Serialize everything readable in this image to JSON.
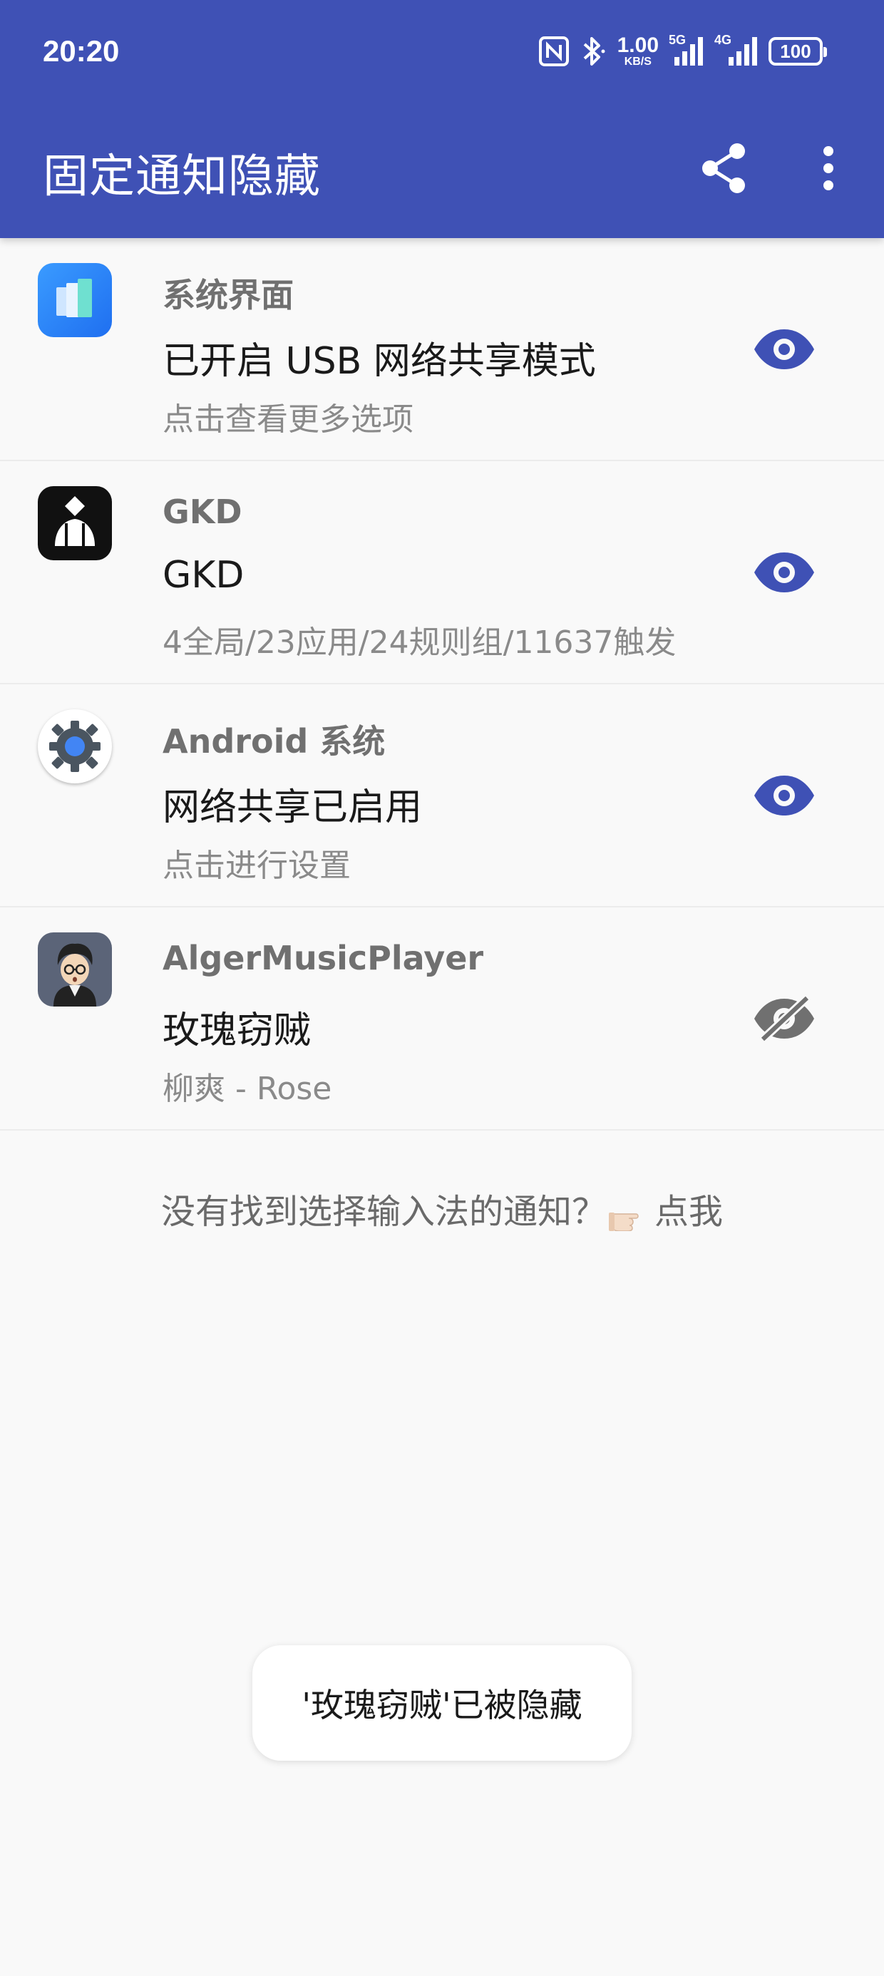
{
  "status_bar": {
    "time": "20:20",
    "net_speed_value": "1.00",
    "net_speed_unit": "KB/S",
    "signal_1_tag": "5G",
    "signal_2_tag": "4G",
    "battery": "100"
  },
  "app_bar": {
    "title": "固定通知隐藏",
    "share_icon": "share-icon",
    "more_icon": "more-vert-icon",
    "color": "#3f51b5"
  },
  "notifications": [
    {
      "app": "系统界面",
      "title": "已开启 USB 网络共享模式",
      "text": "点击查看更多选项",
      "icon": "system-ui-icon",
      "visible": true
    },
    {
      "app": "GKD",
      "title": "GKD",
      "text": "4全局/23应用/24规则组/11637触发",
      "icon": "gkd-icon",
      "visible": true
    },
    {
      "app": "Android 系统",
      "title": "网络共享已启用",
      "text": "点击进行设置",
      "icon": "android-settings-icon",
      "visible": true
    },
    {
      "app": "AlgerMusicPlayer",
      "title": "玫瑰窃贼",
      "text": "柳爽 - Rose",
      "icon": "alger-music-icon",
      "visible": false
    }
  ],
  "hint": {
    "before": "没有找到选择输入法的通知？",
    "after": "点我",
    "icon": "pointing-hand-icon"
  },
  "toast": {
    "text": "'玫瑰窃贼'已被隐藏"
  },
  "colors": {
    "accent": "#3f51b5",
    "eye_visible": "#3f51b5",
    "eye_hidden": "#707070"
  }
}
